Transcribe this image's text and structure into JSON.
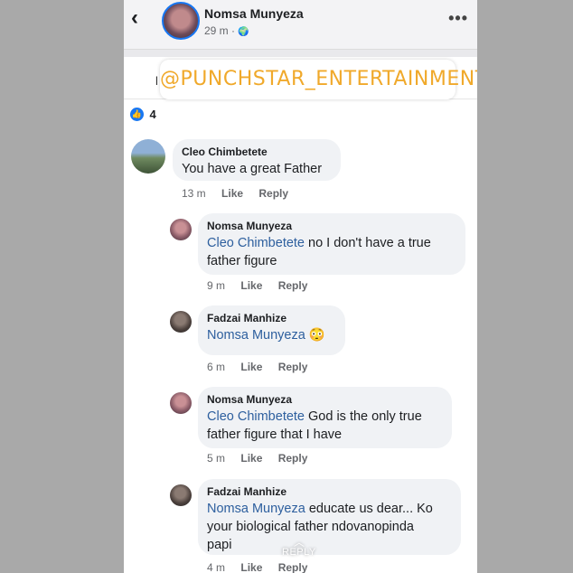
{
  "header": {
    "name": "Nomsa Munyeza",
    "meta": "29 m · ",
    "globe_icon": "🌍",
    "back_icon": "‹",
    "more_icon": "•••"
  },
  "sub_row_glyph": "l",
  "watermark": "@PUNCHSTAR_ENTERTAINMENT",
  "reactions": {
    "icon": "👍",
    "count": "4"
  },
  "comments": [
    {
      "author": "Cleo Chimbetete",
      "text": "You have a great Father",
      "time": "13 m",
      "like": "Like",
      "reply": "Reply"
    },
    {
      "author": "Nomsa Munyeza",
      "mention": "Cleo Chimbetete",
      "text_line1": " no I don't have a true",
      "text_line2": "father figure",
      "time": "9 m",
      "like": "Like",
      "reply": "Reply"
    },
    {
      "author": "Fadzai Manhize",
      "mention": "Nomsa Munyeza",
      "text": " 😳",
      "time": "6 m",
      "like": "Like",
      "reply": "Reply"
    },
    {
      "author": "Nomsa Munyeza",
      "mention": "Cleo Chimbetete",
      "text_line1": " God is the only true",
      "text_line2": "father figure that I have",
      "time": "5 m",
      "like": "Like",
      "reply": "Reply"
    },
    {
      "author": "Fadzai Manhize",
      "mention": "Nomsa Munyeza",
      "text_line1": " educate us dear... Ko",
      "text_line2": "your biological father ndovanopinda",
      "text_line3": "papi",
      "time": "4 m",
      "like": "Like",
      "reply": "Reply"
    }
  ],
  "reply_overlay": {
    "chevron": "︿",
    "label": "REPLY"
  }
}
